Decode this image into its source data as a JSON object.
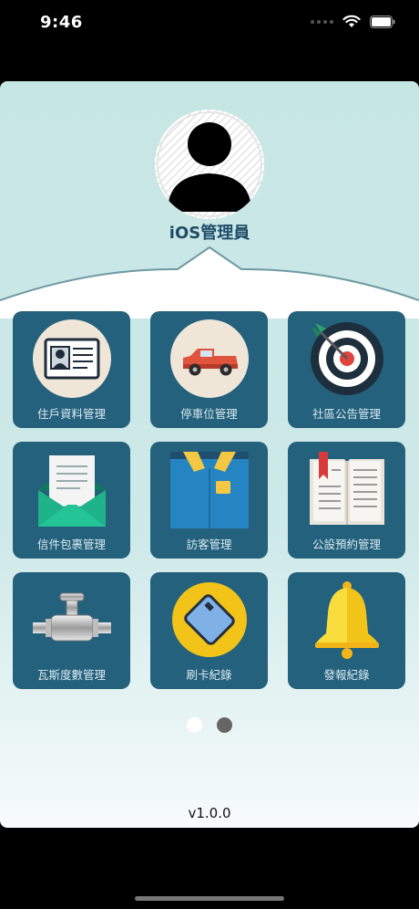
{
  "status_bar": {
    "time": "9:46"
  },
  "profile": {
    "username": "iOS管理員"
  },
  "menu": {
    "items": [
      {
        "label": "住戶資料管理",
        "icon": "resident-id-card-icon"
      },
      {
        "label": "停車位管理",
        "icon": "pickup-truck-icon"
      },
      {
        "label": "社區公告管理",
        "icon": "target-dart-icon"
      },
      {
        "label": "信件包裹管理",
        "icon": "mail-envelope-icon"
      },
      {
        "label": "訪客管理",
        "icon": "visitor-shirt-icon"
      },
      {
        "label": "公設預約管理",
        "icon": "open-book-icon"
      },
      {
        "label": "瓦斯度數管理",
        "icon": "gas-valve-icon"
      },
      {
        "label": "刷卡紀錄",
        "icon": "access-card-icon"
      },
      {
        "label": "發報紀錄",
        "icon": "alarm-bell-icon"
      }
    ]
  },
  "pagination": {
    "current_page": 1,
    "total_pages": 2
  },
  "footer": {
    "version": "v1.0.0"
  },
  "colors": {
    "tile": "#23617d",
    "accent": "#1f4d68",
    "panel": "#c6e6e4"
  }
}
